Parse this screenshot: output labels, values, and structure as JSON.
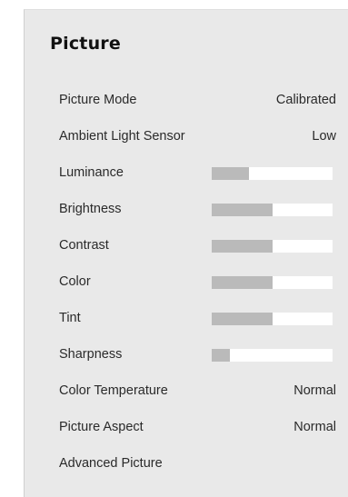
{
  "menu": {
    "title": "Picture",
    "items": [
      {
        "label": "Picture Mode",
        "type": "value",
        "value": "Calibrated"
      },
      {
        "label": "Ambient Light Sensor",
        "type": "value",
        "value": "Low"
      },
      {
        "label": "Luminance",
        "type": "slider",
        "level": 0.31
      },
      {
        "label": "Brightness",
        "type": "slider",
        "level": 0.5
      },
      {
        "label": "Contrast",
        "type": "slider",
        "level": 0.5
      },
      {
        "label": "Color",
        "type": "slider",
        "level": 0.5
      },
      {
        "label": "Tint",
        "type": "slider",
        "level": 0.5
      },
      {
        "label": "Sharpness",
        "type": "slider",
        "level": 0.15
      },
      {
        "label": "Color Temperature",
        "type": "value",
        "value": "Normal"
      },
      {
        "label": "Picture Aspect",
        "type": "value",
        "value": "Normal"
      },
      {
        "label": "Advanced Picture",
        "type": "submenu"
      }
    ]
  },
  "colors": {
    "panel_background": "#e9e9e9",
    "slider_track": "#ffffff",
    "slider_fill": "#bababa",
    "text": "#2a2a2a"
  }
}
